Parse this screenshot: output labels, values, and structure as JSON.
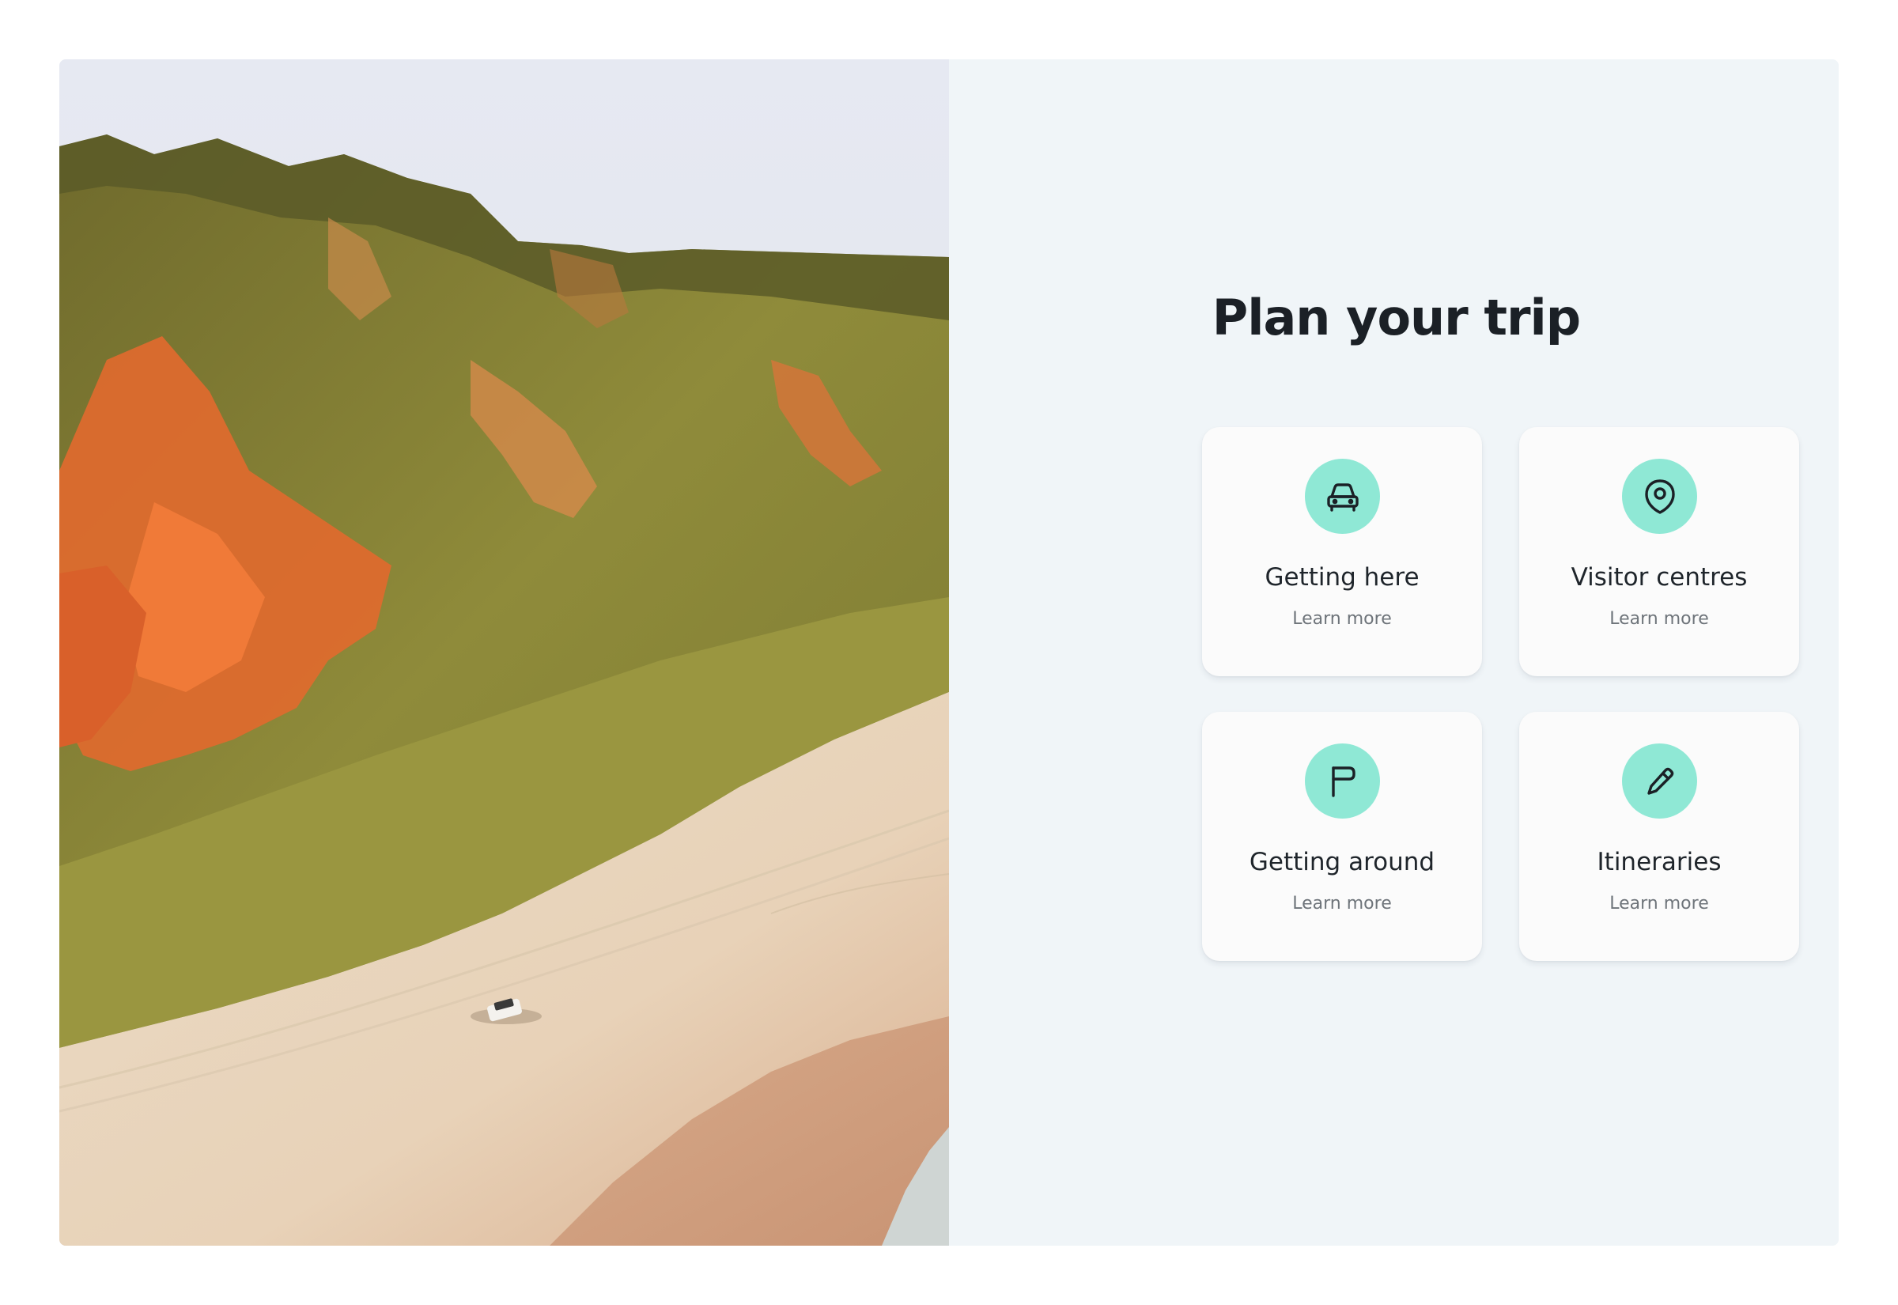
{
  "colors": {
    "panel_background": "#f0f5f8",
    "card_background": "#fbfbfb",
    "icon_badge": "#8fe8d5",
    "title_text": "#1b2026",
    "link_text": "#6e747a"
  },
  "hero_image": {
    "subject": "coastal-cliffs-beach-vehicle"
  },
  "section": {
    "title": "Plan your trip"
  },
  "cards": [
    {
      "title": "Getting here",
      "link": "Learn more",
      "icon": "car-icon"
    },
    {
      "title": "Visitor centres",
      "link": "Learn more",
      "icon": "location-pin-icon"
    },
    {
      "title": "Getting around",
      "link": "Learn more",
      "icon": "flag-icon"
    },
    {
      "title": "Itineraries",
      "link": "Learn more",
      "icon": "pencil-icon"
    }
  ]
}
